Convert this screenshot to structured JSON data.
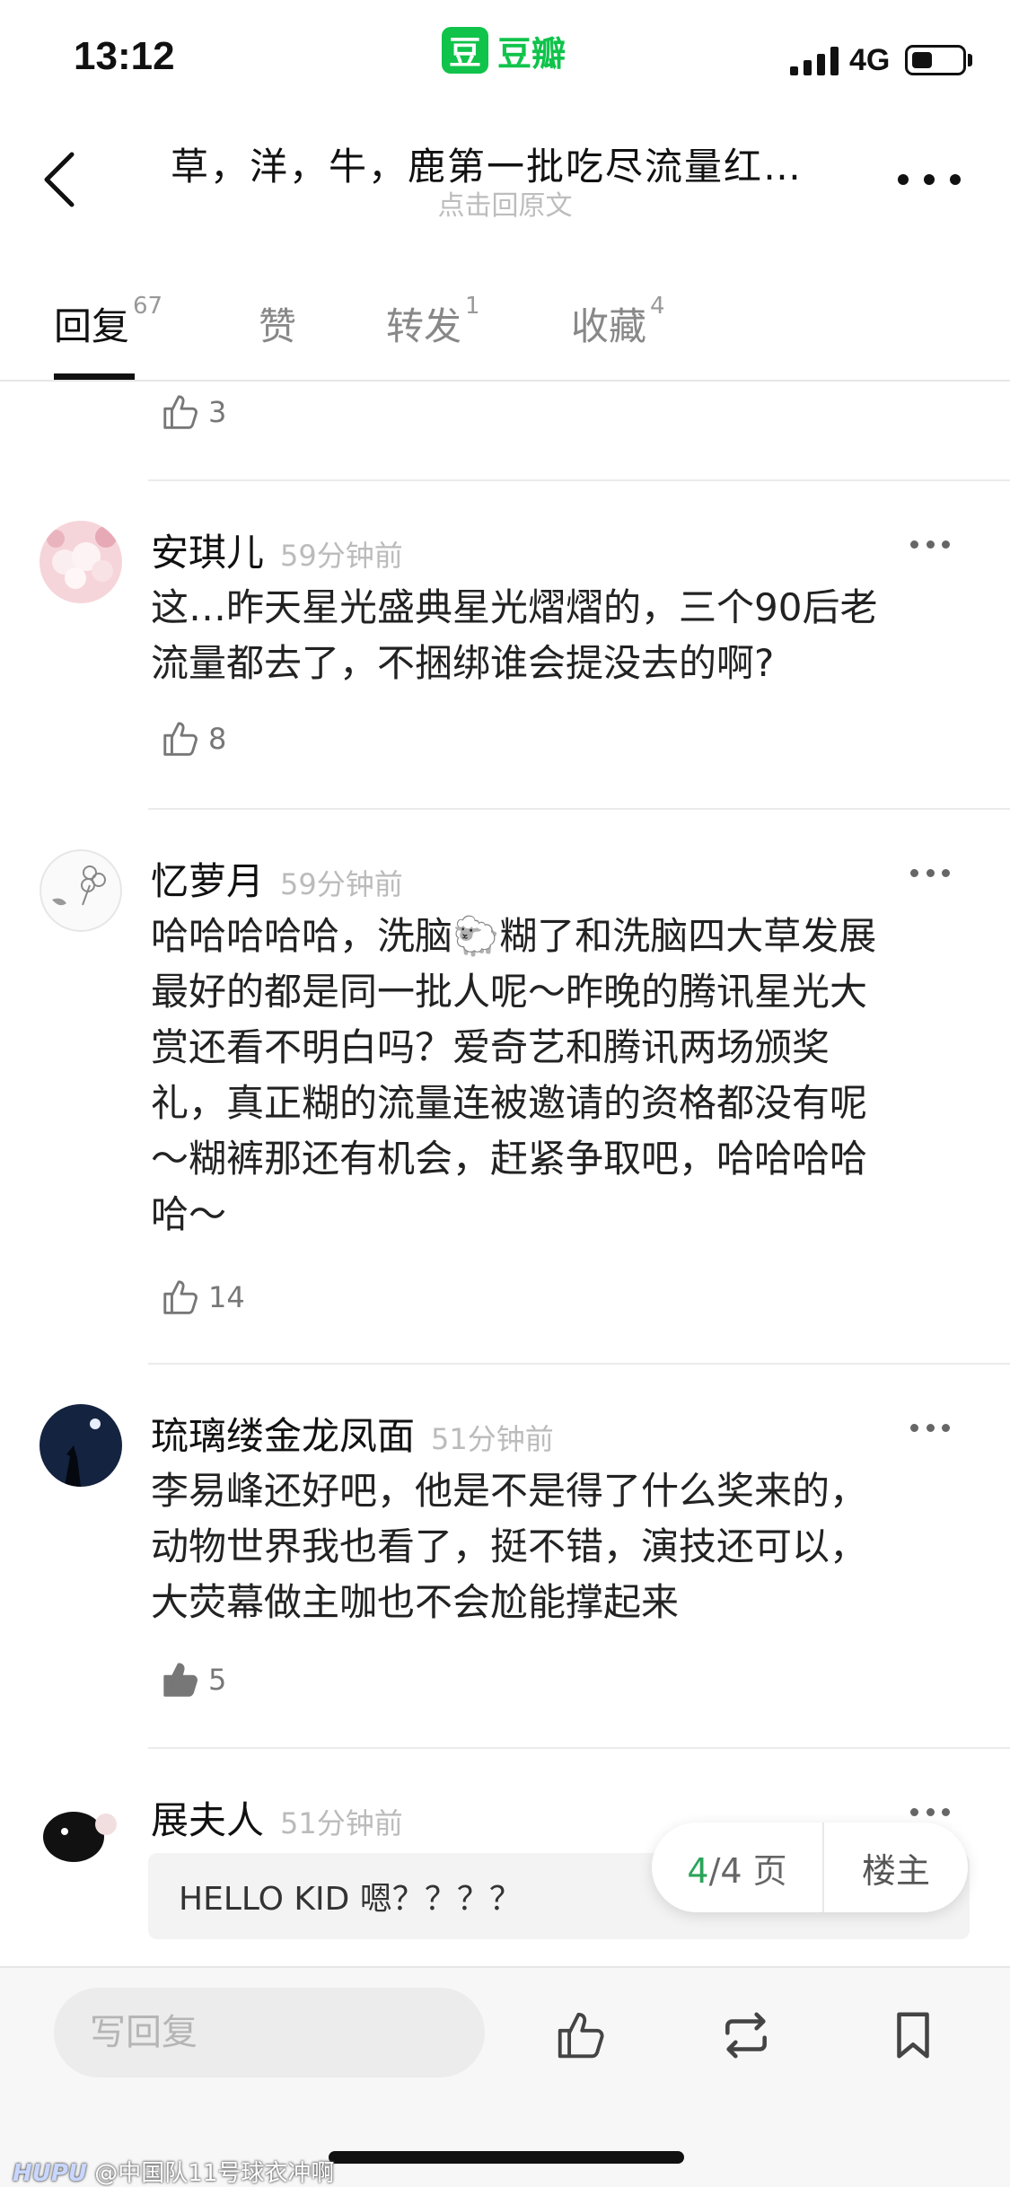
{
  "status_bar": {
    "time": "13:12",
    "network": "4G",
    "app_logo_char": "豆",
    "app_name": "豆瓣"
  },
  "header": {
    "title": "草，洋，牛，鹿第一批吃尽流量红…",
    "subtitle": "点击回原文"
  },
  "tabs": [
    {
      "label": "回复",
      "count": "67"
    },
    {
      "label": "赞",
      "count": ""
    },
    {
      "label": "转发",
      "count": "1"
    },
    {
      "label": "收藏",
      "count": "4"
    }
  ],
  "top_like_count": "3",
  "comments": [
    {
      "user": "安琪儿",
      "time": "59分钟前",
      "lines": [
        "这…昨天星光盛典星光熠熠的，三个90后老",
        "流量都去了，不捆绑谁会提没去的啊?"
      ],
      "likes": "8"
    },
    {
      "user": "忆萝月",
      "time": "59分钟前",
      "lines": [
        "哈哈哈哈哈，洗脑🐑糊了和洗脑四大草发展",
        "最好的都是同一批人呢～昨晚的腾讯星光大",
        "赏还看不明白吗？爱奇艺和腾讯两场颁奖",
        "礼，真正糊的流量连被邀请的资格都没有呢",
        "～糊裤那还有机会，赶紧争取吧，哈哈哈哈",
        "哈～"
      ],
      "likes": "14"
    },
    {
      "user": "琉璃缕金龙凤面",
      "time": "51分钟前",
      "lines": [
        "李易峰还好吧，他是不是得了什么奖来的，",
        "动物世界我也看了，挺不错，演技还可以，",
        "大荧幕做主咖也不会尬能撑起来"
      ],
      "likes": "5"
    },
    {
      "user": "展夫人",
      "time": "51分钟前",
      "quote": "HELLO KID 嗯？？？？"
    }
  ],
  "pager": {
    "current": "4",
    "total": "/4 页",
    "op": "楼主"
  },
  "bottom_bar": {
    "reply_placeholder": "写回复"
  },
  "watermark": {
    "brand": "HUPU",
    "text": " @中国队11号球衣冲啊"
  },
  "colors": {
    "accent_green": "#10c34b",
    "pager_green": "#2aa45a"
  }
}
